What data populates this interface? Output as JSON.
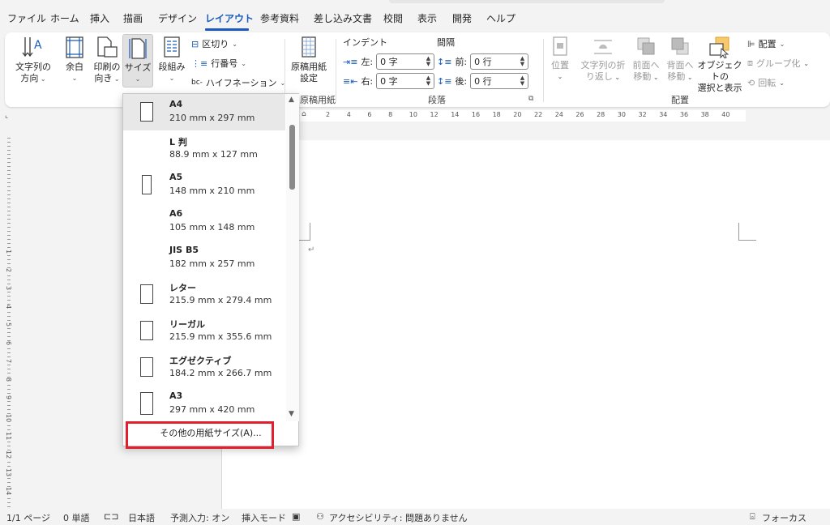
{
  "tabs": [
    "ファイル",
    "ホーム",
    "挿入",
    "描画",
    "デザイン",
    "レイアウト",
    "参考資料",
    "差し込み文書",
    "校閲",
    "表示",
    "開発",
    "ヘルプ"
  ],
  "active_tab": "レイアウト",
  "ribbon": {
    "text_direction": {
      "line1": "文字列の",
      "line2": "方向"
    },
    "margins": {
      "line1": "余白"
    },
    "orientation": {
      "line1": "印刷の",
      "line2": "向き"
    },
    "size": {
      "line1": "サイズ"
    },
    "columns": {
      "line1": "段組み"
    },
    "breaks": "区切り",
    "line_numbers": "行番号",
    "hyphenation": "ハイフネーション",
    "manuscript": {
      "line1": "原稿用紙",
      "line2": "設定"
    },
    "manuscript_group": "原稿用紙",
    "indent_label": "インデント",
    "spacing_label": "間隔",
    "indent_left_label": "左:",
    "indent_left_value": "0 字",
    "indent_right_label": "右:",
    "indent_right_value": "0 字",
    "space_before_label": "前:",
    "space_before_value": "0 行",
    "space_after_label": "後:",
    "space_after_value": "0 行",
    "paragraph_group": "段落",
    "position": {
      "line1": "位置"
    },
    "wrap_text": {
      "line1": "文字列の折",
      "line2": "り返し"
    },
    "bring_forward": {
      "line1": "前面へ",
      "line2": "移動"
    },
    "send_backward": {
      "line1": "背面へ",
      "line2": "移動"
    },
    "selection_pane": {
      "line1": "オブジェクトの",
      "line2": "選択と表示"
    },
    "align": "配置",
    "group": "グループ化",
    "rotate": "回転",
    "arrange_group": "配置"
  },
  "ruler_numbers": [
    "2",
    "4",
    "6",
    "8",
    "10",
    "12",
    "14",
    "16",
    "18",
    "20",
    "22",
    "24",
    "26",
    "28",
    "30",
    "32",
    "34",
    "36",
    "38",
    "40"
  ],
  "vruler_numbers": [
    "1",
    "2",
    "3",
    "4",
    "5",
    "6",
    "7",
    "8",
    "9",
    "10",
    "11",
    "12",
    "13",
    "14"
  ],
  "size_menu": {
    "items": [
      {
        "name": "A4",
        "dim": "210 mm x 297 mm",
        "icon": "portrait"
      },
      {
        "name": "L 判",
        "dim": "88.9 mm x 127 mm",
        "icon": ""
      },
      {
        "name": "A5",
        "dim": "148 mm x 210 mm",
        "icon": "portrait"
      },
      {
        "name": "A6",
        "dim": "105 mm x 148 mm",
        "icon": ""
      },
      {
        "name": "JIS B5",
        "dim": "182 mm x 257 mm",
        "icon": ""
      },
      {
        "name": "レター",
        "dim": "215.9 mm x 279.4 mm",
        "icon": "portrait"
      },
      {
        "name": "リーガル",
        "dim": "215.9 mm x 355.6 mm",
        "icon": "portrait"
      },
      {
        "name": "エグゼクティブ",
        "dim": "184.2 mm x 266.7 mm",
        "icon": "portrait"
      },
      {
        "name": "A3",
        "dim": "297 mm x 420 mm",
        "icon": "portrait"
      }
    ],
    "more": "その他の用紙サイズ(A)..."
  },
  "status": {
    "page": "1/1 ページ",
    "words": "0 単語",
    "language": "日本語",
    "predictive": "予測入力: オン",
    "insert_mode": "挿入モード",
    "accessibility": "アクセシビリティ: 問題ありません",
    "focus": "フォーカス"
  },
  "colors": {
    "accent": "#185abd",
    "highlight": "#e0202f"
  }
}
